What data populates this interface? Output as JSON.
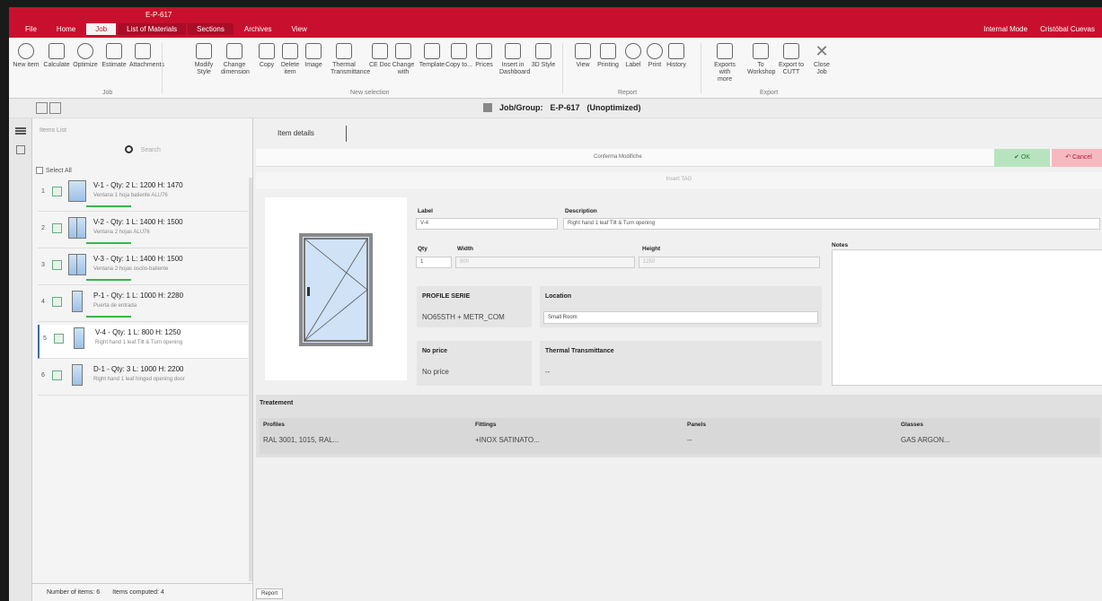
{
  "window": {
    "title": "E-P-617"
  },
  "menu_tabs": [
    {
      "label": "File"
    },
    {
      "label": "Home"
    },
    {
      "label": "Job"
    },
    {
      "label": "List of Materials"
    },
    {
      "label": "Sections"
    },
    {
      "label": "Archives"
    },
    {
      "label": "View"
    }
  ],
  "right_links": {
    "first": "Internal Mode",
    "user": "Cristóbal Cuevas"
  },
  "ribbon": {
    "buttons": [
      {
        "label": "New item",
        "icon": "plus-icon"
      },
      {
        "label": "Calculate",
        "icon": "scale-icon"
      },
      {
        "label": "Optimize",
        "icon": "gauge-icon"
      },
      {
        "label": "Estimate",
        "icon": "estimate-icon"
      },
      {
        "label": "Attachments",
        "icon": "paperclip-icon"
      },
      {
        "label": "Modify Style",
        "icon": "tools-icon"
      },
      {
        "label": "Change dimension",
        "icon": "resize-icon"
      },
      {
        "label": "Copy",
        "icon": "copy-icon"
      },
      {
        "label": "Delete item",
        "icon": "trash-icon"
      },
      {
        "label": "Image",
        "icon": "hand-icon"
      },
      {
        "label": "Thermal Transmittance",
        "icon": "thermal-icon"
      },
      {
        "label": "CE Doc",
        "icon": "ce-icon"
      },
      {
        "label": "Change with",
        "icon": "change-icon"
      },
      {
        "label": "Template",
        "icon": "template-icon"
      },
      {
        "label": "Copy to...",
        "icon": "copy-to-icon"
      },
      {
        "label": "Prices",
        "icon": "chart-icon"
      },
      {
        "label": "Insert in Dashboard",
        "icon": "insert-icon"
      },
      {
        "label": "3D Style",
        "icon": "cube-icon"
      },
      {
        "label": "View",
        "icon": "view-icon"
      },
      {
        "label": "Printing",
        "icon": "printer-icon"
      },
      {
        "label": "Label",
        "icon": "label-icon"
      },
      {
        "label": "Print",
        "icon": "print-icon"
      },
      {
        "label": "History",
        "icon": "history-icon"
      },
      {
        "label": "Exports with more",
        "icon": "export-icon"
      },
      {
        "label": "To Workshop",
        "icon": "workshop-icon"
      },
      {
        "label": "Export to CUTT",
        "icon": "export-cutt-icon"
      },
      {
        "label": "Close Job",
        "icon": "close-icon"
      }
    ],
    "groups": {
      "job": "Job",
      "new_selection": "New selection",
      "report": "Report",
      "export": "Export"
    }
  },
  "job_header": {
    "label": "Job/Group:",
    "id": "E-P-617",
    "status": "(Unoptimized)"
  },
  "left_panel": {
    "list_title": "Items List",
    "search_placeholder": "Search",
    "select_all": "Select All",
    "items": [
      {
        "num": "1",
        "title": "V-1 - Qty: 2 L: 1200 H: 1470",
        "desc": "Ventana 1 hoja batiente ALU76"
      },
      {
        "num": "2",
        "title": "V-2 - Qty: 1 L: 1400 H: 1500",
        "desc": "Ventana 2 hojas ALU76"
      },
      {
        "num": "3",
        "title": "V-3 - Qty: 1 L: 1400 H: 1500",
        "desc": "Ventana 2 hojas oscilo-batiente"
      },
      {
        "num": "4",
        "title": "P-1 - Qty: 1 L: 1000 H: 2280",
        "desc": "Puerta de entrada"
      },
      {
        "num": "5",
        "title": "V-4 - Qty: 1 L: 800 H: 1250",
        "desc": "Right hand 1 leaf Tilt & Turn opening"
      },
      {
        "num": "6",
        "title": "D-1 - Qty: 3 L: 1000 H: 2200",
        "desc": "Right hand 1 leaf hinged opening door"
      }
    ],
    "footer": {
      "items_label": "Number of items:",
      "items_value": "6",
      "computed_label": "Items computed:",
      "computed_value": "4"
    }
  },
  "main": {
    "tab": "Item details",
    "action_center": "Conferma Modifiche",
    "ok": "OK",
    "cancel": "Cancel",
    "insert": "Insert TAG",
    "label_label": "Label",
    "label_value": "V-4",
    "desc_label": "Description",
    "desc_value": "Right hand 1 leaf Tilt & Turn opening",
    "qty_label": "Qty",
    "qty_value": "1",
    "width_label": "Width",
    "width_value": "800",
    "height_label": "Height",
    "height_value": "1250",
    "notes_label": "Notes",
    "profile_header": "PROFILE SERIE",
    "profile_value": "NO65STH + METR_COM",
    "location_header": "Location",
    "location_value": "Small Room",
    "price_header": "No price",
    "price_value": "No price",
    "thermal_header": "Thermal Transmittance",
    "thermal_value": "--",
    "treatment": {
      "title": "Treatement",
      "profiles_label": "Profiles",
      "profiles_value": "RAL 3001, 1015, RAL...",
      "fittings_label": "Fittings",
      "fittings_value": "+INOX SATINATO...",
      "panels_label": "Panels",
      "panels_value": "--",
      "glasses_label": "Glasses",
      "glasses_value": "GAS ARGON..."
    },
    "report_button": "Report"
  },
  "colors": {
    "accent": "#c8102e",
    "ok": "#b7e4bf",
    "cancel": "#f6b9c0"
  }
}
